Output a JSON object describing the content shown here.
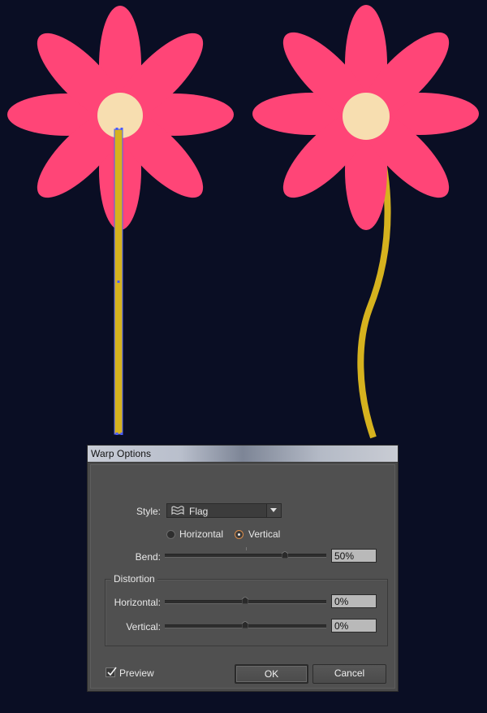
{
  "dialog": {
    "title": "Warp Options",
    "style_label": "Style:",
    "style_value": "Flag",
    "style_icon": "flag-warp-icon",
    "orientation": {
      "horizontal_label": "Horizontal",
      "vertical_label": "Vertical",
      "selected": "Vertical"
    },
    "bend": {
      "label": "Bend:",
      "value": "50%",
      "level": 0.5
    },
    "distortion": {
      "title": "Distortion",
      "horizontal": {
        "label": "Horizontal:",
        "value": "0%",
        "level": 0
      },
      "vertical": {
        "label": "Vertical:",
        "value": "0%",
        "level": 0
      }
    },
    "preview": {
      "label": "Preview",
      "checked": true
    },
    "ok_label": "OK",
    "cancel_label": "Cancel"
  },
  "colors": {
    "background": "#0a0e24",
    "petal": "#ff4577",
    "flower_center": "#f7deb0",
    "stem": "#d6b21e",
    "selection": "#4a5cff"
  }
}
